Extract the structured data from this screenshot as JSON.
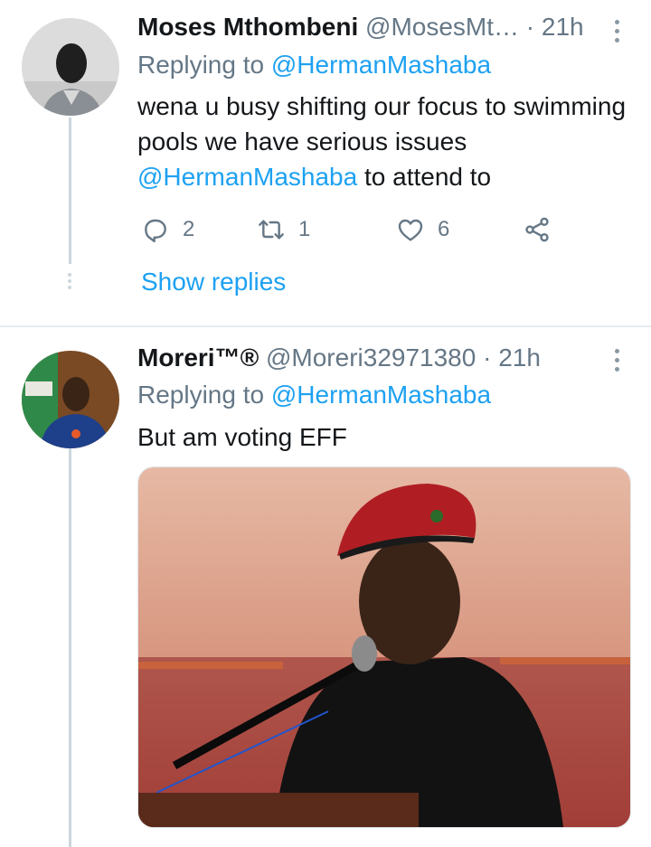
{
  "tweets": [
    {
      "name": "Moses Mthombeni",
      "handle": "@MosesMt…",
      "time": "· 21h",
      "replying_prefix": "Replying to",
      "replying_to": "@HermanMashaba",
      "text_part1": "wena u busy shifting our focus to swimming pools we have serious issues",
      "text_mention": "@HermanMashaba",
      "text_part2": "to attend to",
      "replies": "2",
      "retweets": "1",
      "likes": "6",
      "show_replies": "Show replies"
    },
    {
      "name": "Moreri™®",
      "handle": "@Moreri32971380",
      "time": "· 21h",
      "replying_prefix": "Replying to",
      "replying_to": "@HermanMashaba",
      "text": "But am voting EFF"
    }
  ],
  "colors": {
    "accent": "#1da1f2",
    "muted": "#657786",
    "divider": "#e6ecf0"
  },
  "icons": [
    "reply-icon",
    "retweet-icon",
    "like-icon",
    "share-icon",
    "more-icon"
  ]
}
